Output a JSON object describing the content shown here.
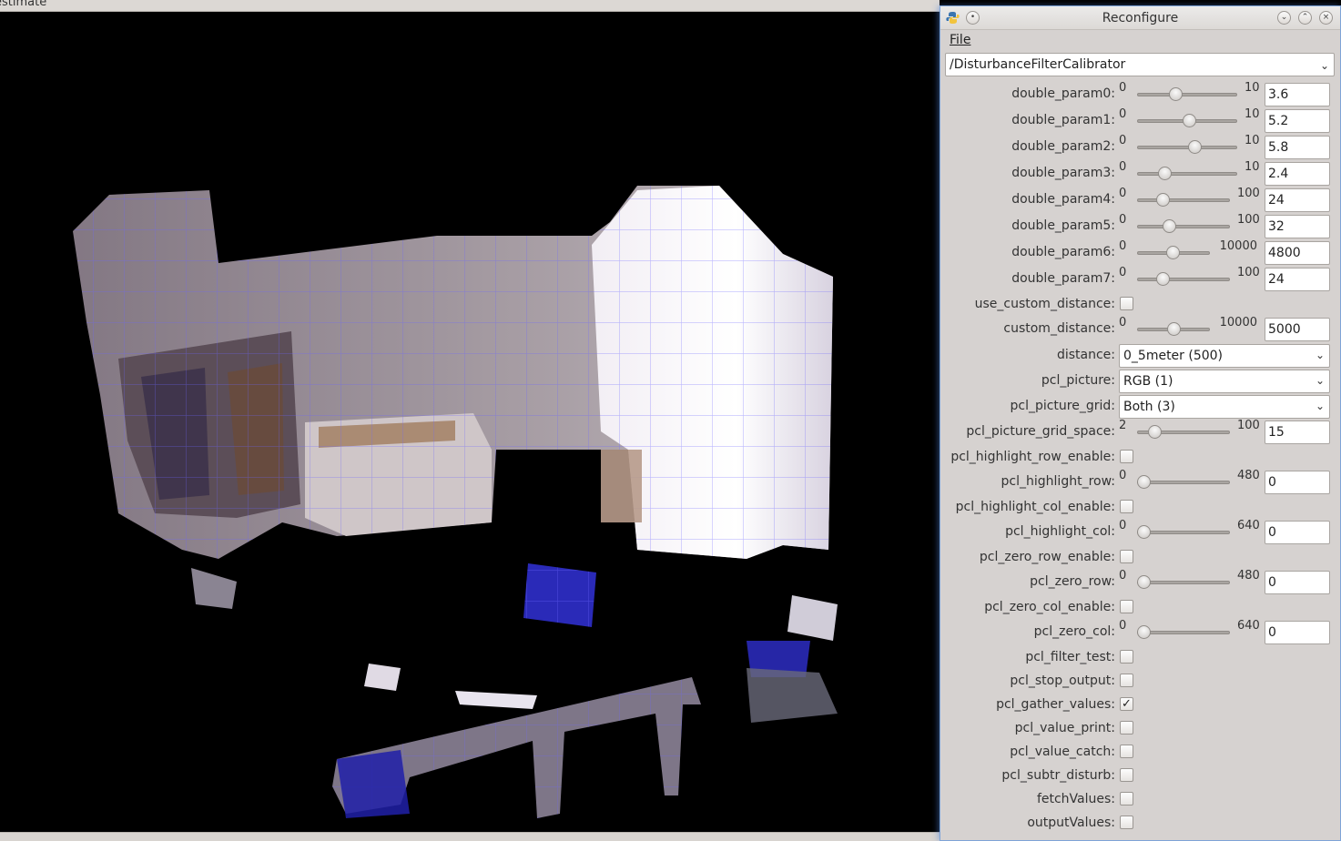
{
  "viewer": {
    "title": "estimate"
  },
  "window": {
    "title": "Reconfigure",
    "menu_file": "File",
    "node": "/DisturbanceFilterCalibrator"
  },
  "colors": {
    "accent": "#7ea4d8",
    "panel": "#d6d2d0",
    "grid": "#6b64ff"
  },
  "params": [
    {
      "label": "double_param0:",
      "type": "slider",
      "min": "0",
      "max": "10",
      "value": "3.6"
    },
    {
      "label": "double_param1:",
      "type": "slider",
      "min": "0",
      "max": "10",
      "value": "5.2"
    },
    {
      "label": "double_param2:",
      "type": "slider",
      "min": "0",
      "max": "10",
      "value": "5.8"
    },
    {
      "label": "double_param3:",
      "type": "slider",
      "min": "0",
      "max": "10",
      "value": "2.4"
    },
    {
      "label": "double_param4:",
      "type": "slider",
      "min": "0",
      "max": "100",
      "value": "24"
    },
    {
      "label": "double_param5:",
      "type": "slider",
      "min": "0",
      "max": "100",
      "value": "32"
    },
    {
      "label": "double_param6:",
      "type": "slider",
      "min": "0",
      "max": "10000",
      "value": "4800"
    },
    {
      "label": "double_param7:",
      "type": "slider",
      "min": "0",
      "max": "100",
      "value": "24"
    },
    {
      "label": "use_custom_distance:",
      "type": "check",
      "checked": false
    },
    {
      "label": "custom_distance:",
      "type": "slider",
      "min": "0",
      "max": "10000",
      "value": "5000"
    },
    {
      "label": "distance:",
      "type": "dropdown",
      "value": "0_5meter (500)"
    },
    {
      "label": "pcl_picture:",
      "type": "dropdown",
      "value": "RGB (1)"
    },
    {
      "label": "pcl_picture_grid:",
      "type": "dropdown",
      "value": "Both (3)"
    },
    {
      "label": "pcl_picture_grid_space:",
      "type": "slider",
      "min": "2",
      "max": "100",
      "value": "15"
    },
    {
      "label": "pcl_highlight_row_enable:",
      "type": "check",
      "checked": false
    },
    {
      "label": "pcl_highlight_row:",
      "type": "slider",
      "min": "0",
      "max": "480",
      "value": "0"
    },
    {
      "label": "pcl_highlight_col_enable:",
      "type": "check",
      "checked": false
    },
    {
      "label": "pcl_highlight_col:",
      "type": "slider",
      "min": "0",
      "max": "640",
      "value": "0"
    },
    {
      "label": "pcl_zero_row_enable:",
      "type": "check",
      "checked": false
    },
    {
      "label": "pcl_zero_row:",
      "type": "slider",
      "min": "0",
      "max": "480",
      "value": "0"
    },
    {
      "label": "pcl_zero_col_enable:",
      "type": "check",
      "checked": false
    },
    {
      "label": "pcl_zero_col:",
      "type": "slider",
      "min": "0",
      "max": "640",
      "value": "0"
    },
    {
      "label": "pcl_filter_test:",
      "type": "check",
      "checked": false
    },
    {
      "label": "pcl_stop_output:",
      "type": "check",
      "checked": false
    },
    {
      "label": "pcl_gather_values:",
      "type": "check",
      "checked": true
    },
    {
      "label": "pcl_value_print:",
      "type": "check",
      "checked": false
    },
    {
      "label": "pcl_value_catch:",
      "type": "check",
      "checked": false
    },
    {
      "label": "pcl_subtr_disturb:",
      "type": "check",
      "checked": false
    },
    {
      "label": "fetchValues:",
      "type": "check",
      "checked": false
    },
    {
      "label": "outputValues:",
      "type": "check",
      "checked": false
    }
  ]
}
